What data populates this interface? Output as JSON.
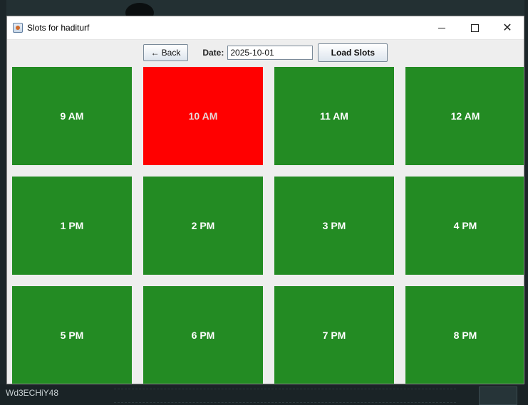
{
  "window": {
    "title": "Slots for haditurf",
    "controls": {
      "minimize": "—",
      "maximize": "☐",
      "close": "✕"
    }
  },
  "toolbar": {
    "back_label": "Back",
    "back_arrow": "←",
    "date_label": "Date:",
    "date_value": "2025-10-01",
    "load_label": "Load Slots"
  },
  "slots": [
    {
      "label": "9 AM",
      "status": "available"
    },
    {
      "label": "10 AM",
      "status": "booked"
    },
    {
      "label": "11 AM",
      "status": "available"
    },
    {
      "label": "12 AM",
      "status": "available"
    },
    {
      "label": "1 PM",
      "status": "available"
    },
    {
      "label": "2 PM",
      "status": "available"
    },
    {
      "label": "3 PM",
      "status": "available"
    },
    {
      "label": "4 PM",
      "status": "available"
    },
    {
      "label": "5 PM",
      "status": "available"
    },
    {
      "label": "6 PM",
      "status": "available"
    },
    {
      "label": "7 PM",
      "status": "available"
    },
    {
      "label": "8 PM",
      "status": "available"
    }
  ],
  "colors": {
    "available": "#238b23",
    "booked": "#ff0000"
  },
  "background": {
    "bottom_text": "Wd3ECHiY48"
  }
}
